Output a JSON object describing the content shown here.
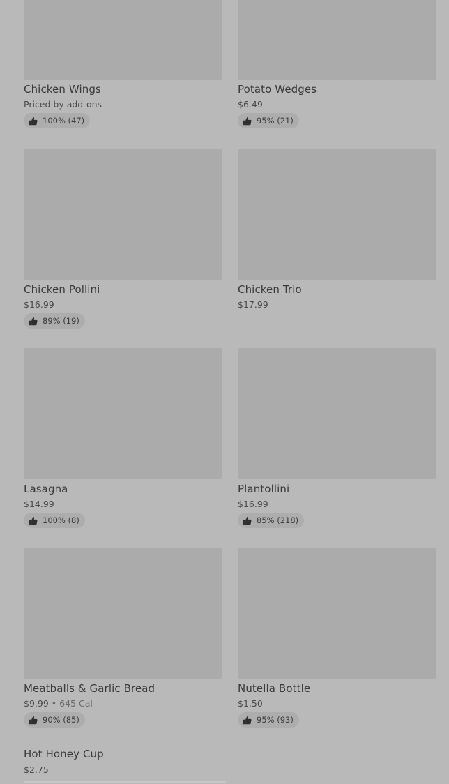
{
  "menu": {
    "items": [
      {
        "name": "Chicken Wings",
        "price": "Priced by add-ons",
        "rating": "100% (47)"
      },
      {
        "name": "Potato Wedges",
        "price": "$6.49",
        "rating": "95% (21)"
      },
      {
        "name": "Chicken Pollini",
        "price": "$16.99",
        "rating": "89% (19)"
      },
      {
        "name": "Chicken Trio",
        "price": "$17.99",
        "rating": ""
      },
      {
        "name": "Lasagna",
        "price": "$14.99",
        "rating": "100% (8)"
      },
      {
        "name": "Plantollini",
        "price": "$16.99",
        "rating": "85% (218)"
      },
      {
        "name": "Meatballs  & Garlic Bread",
        "price": "$9.99",
        "calories": "645 Cal",
        "separator": "•",
        "rating": "90% (85)"
      },
      {
        "name": "Nutella Bottle",
        "price": "$1.50",
        "rating": "95% (93)"
      },
      {
        "name": "Hot Honey Cup",
        "price": "$2.75"
      }
    ]
  },
  "icons": {
    "rating": "thumbs-up-icon"
  }
}
